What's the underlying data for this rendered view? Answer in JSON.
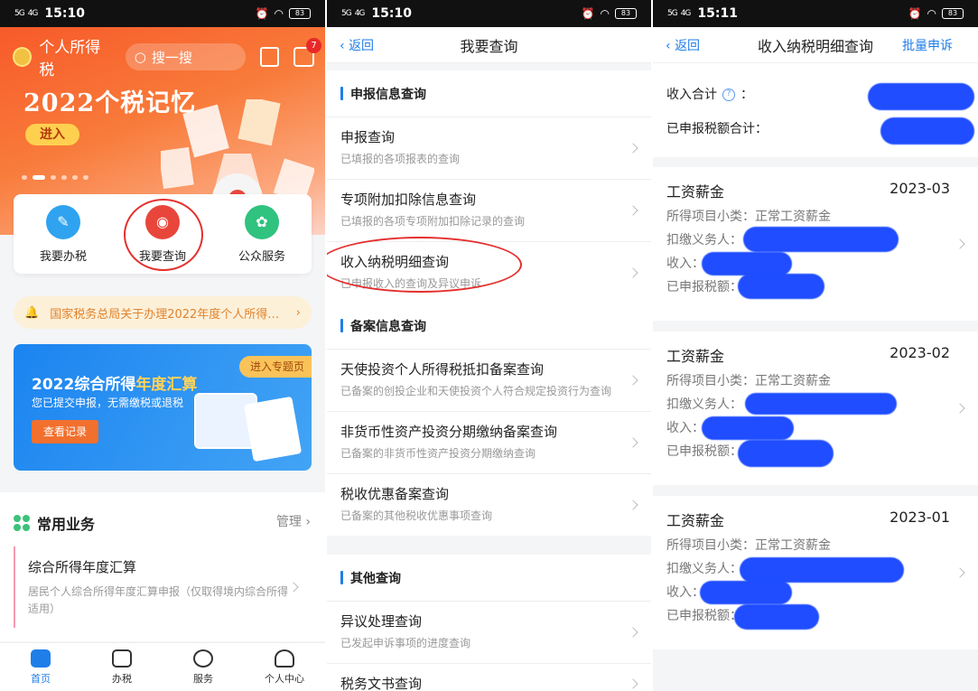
{
  "status_bars": [
    {
      "signal": "5G",
      "net": "4G",
      "time": "15:10",
      "battery": "83"
    },
    {
      "signal": "5G",
      "net": "4G",
      "time": "15:10",
      "battery": "83"
    },
    {
      "signal": "5G",
      "net": "4G",
      "time": "15:11",
      "battery": "83"
    }
  ],
  "home": {
    "app_title": "个人所得税",
    "search_placeholder": "搜一搜",
    "message_count": "7",
    "hero_title": "2022个税记忆",
    "hero_button": "进入",
    "quick_actions": [
      {
        "label": "我要办税",
        "icon": "edit-icon",
        "color": "#2fa3f0"
      },
      {
        "label": "我要查询",
        "icon": "search-icon",
        "color": "#e9463b"
      },
      {
        "label": "公众服务",
        "icon": "flower-icon",
        "color": "#30c27f"
      }
    ],
    "notice": "国家税务总局关于办理2022年度个人所得…",
    "banner": {
      "title_prefix": "2022综合所得",
      "title_highlight": "年度汇算",
      "subtitle": "您已提交申报，无需缴税或退税",
      "button": "查看记录",
      "tag": "进入专题页"
    },
    "common": {
      "title": "常用业务",
      "manage": "管理",
      "card_title": "综合所得年度汇算",
      "card_desc": "居民个人综合所得年度汇算申报（仅取得境内综合所得适用）"
    },
    "tabs": [
      {
        "label": "首页",
        "icon": "home-icon"
      },
      {
        "label": "办税",
        "icon": "form-icon"
      },
      {
        "label": "服务",
        "icon": "heart-hand-icon"
      },
      {
        "label": "个人中心",
        "icon": "person-icon"
      }
    ]
  },
  "query": {
    "back": "返回",
    "title": "我要查询",
    "sections": [
      {
        "title": "申报信息查询",
        "items": [
          {
            "title": "申报查询",
            "desc": "已填报的各项报表的查询"
          },
          {
            "title": "专项附加扣除信息查询",
            "desc": "已填报的各项专项附加扣除记录的查询"
          },
          {
            "title": "收入纳税明细查询",
            "desc": "已申报收入的查询及异议申诉"
          }
        ]
      },
      {
        "title": "备案信息查询",
        "items": [
          {
            "title": "天使投资个人所得税抵扣备案查询",
            "desc": "已备案的创投企业和天使投资个人符合规定投资行为查询"
          },
          {
            "title": "非货币性资产投资分期缴纳备案查询",
            "desc": "已备案的非货币性资产投资分期缴纳查询"
          },
          {
            "title": "税收优惠备案查询",
            "desc": "已备案的其他税收优惠事项查询"
          }
        ]
      },
      {
        "title": "其他查询",
        "items": [
          {
            "title": "异议处理查询",
            "desc": "已发起申诉事项的进度查询"
          },
          {
            "title": "税务文书查询",
            "desc": ""
          }
        ]
      }
    ]
  },
  "detail": {
    "back": "返回",
    "title": "收入纳税明细查询",
    "action": "批量申诉",
    "total_income_label": "收入合计",
    "total_income_colon": "：",
    "declared_tax_label": "已申报税额合计：",
    "records": [
      {
        "type": "工资薪金",
        "month": "2023-03",
        "subtype_label": "所得项目小类：",
        "subtype": "正常工资薪金",
        "payer_label": "扣缴义务人：",
        "income_label": "收入：",
        "tax_label": "已申报税额："
      },
      {
        "type": "工资薪金",
        "month": "2023-02",
        "subtype_label": "所得项目小类：",
        "subtype": "正常工资薪金",
        "payer_label": "扣缴义务人：",
        "income_label": "收入：",
        "tax_label": "已申报税额："
      },
      {
        "type": "工资薪金",
        "month": "2023-01",
        "subtype_label": "所得项目小类：",
        "subtype": "正常工资薪金",
        "payer_label": "扣缴义务人：",
        "income_label": "收入：",
        "tax_label": "已申报税额："
      }
    ]
  },
  "colors": {
    "accent": "#1f7ee8",
    "hero": "#f75a2a",
    "annotation": "#e4302e",
    "redaction": "#1f4dff"
  }
}
